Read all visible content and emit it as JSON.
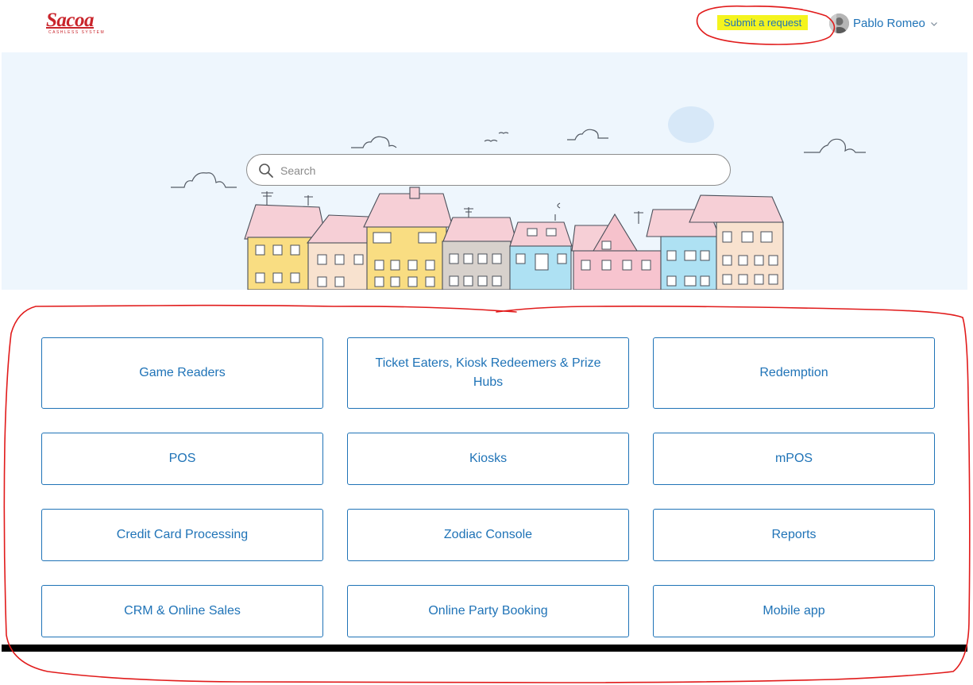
{
  "header": {
    "logo_text": "Sacoa",
    "logo_tagline": "CASHLESS SYSTEM",
    "submit_request_label": "Submit a request",
    "user_name": "Pablo Romeo"
  },
  "search": {
    "placeholder": "Search"
  },
  "categories": [
    "Game Readers",
    "Ticket Eaters, Kiosk Redeemers & Prize Hubs",
    "Redemption",
    "POS",
    "Kiosks",
    "mPOS",
    "Credit Card Processing",
    "Zodiac Console",
    "Reports",
    "CRM & Online Sales",
    "Online Party Booking",
    "Mobile app"
  ],
  "colors": {
    "link": "#1f73b7",
    "highlight": "#f4f41e",
    "annotation": "#e11b1b",
    "hero_bg": "#eef6fd",
    "logo": "#c9242b"
  },
  "icons": [
    "search-icon",
    "chevron-down-icon",
    "avatar"
  ]
}
